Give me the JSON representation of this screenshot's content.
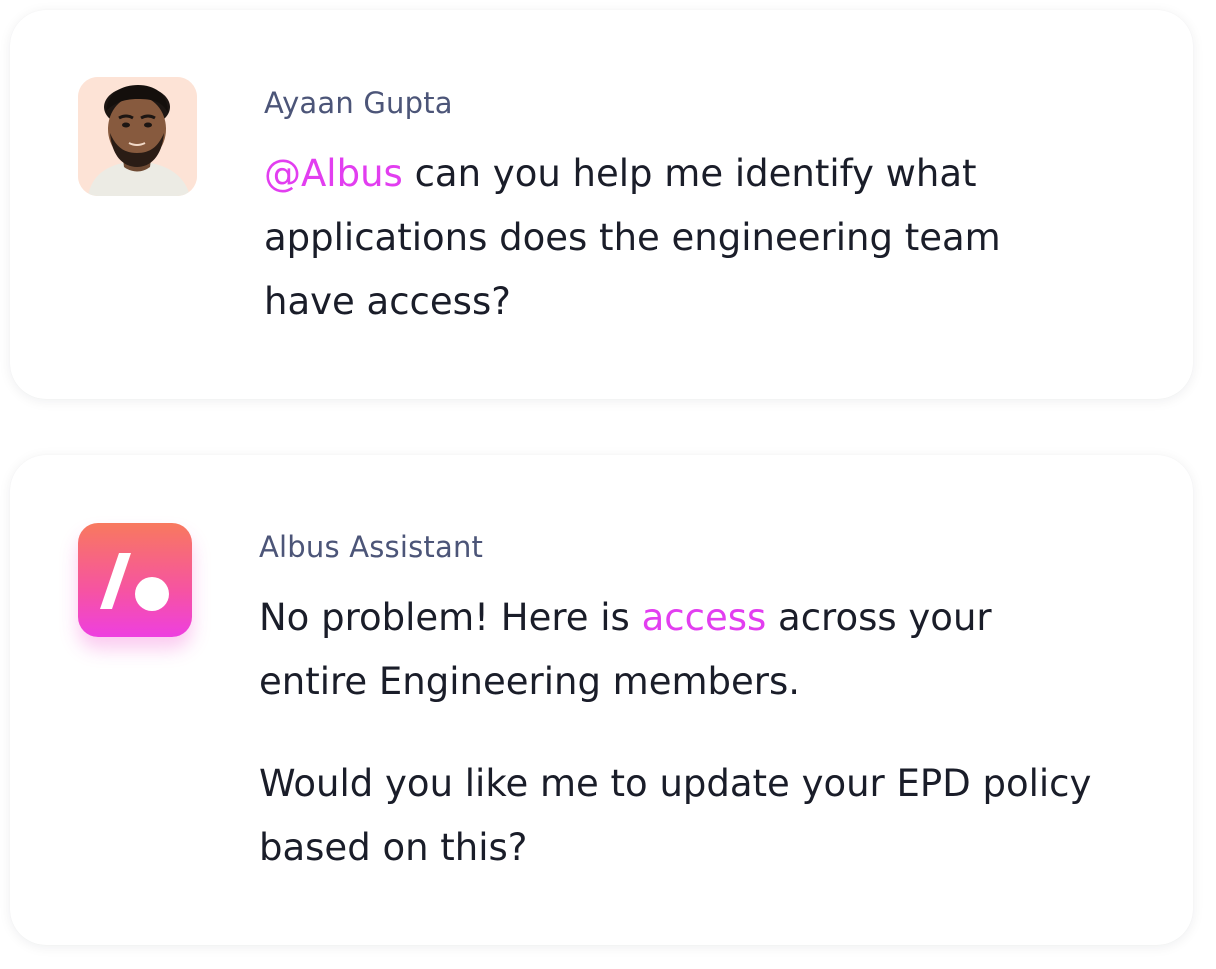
{
  "colors": {
    "accent": "#e23ef0",
    "sender_name": "#4c5578",
    "body_text": "#1a1d29",
    "card_bg": "#ffffff"
  },
  "messages": [
    {
      "sender": "Ayaan Gupta",
      "avatar": "user-photo-avatar",
      "text": {
        "mention": "@Albus",
        "line1_rest": " can you help me identify what",
        "line2": "applications does the engineering team",
        "line3": "have access?"
      }
    },
    {
      "sender": "Albus Assistant",
      "avatar": "albus-logo-icon",
      "paragraph1": {
        "before": "No problem! Here is ",
        "link": "access",
        "after": " across your",
        "line2": "entire Engineering members."
      },
      "paragraph2": {
        "line1": "Would you like me to update your EPD policy",
        "line2": "based on this?"
      }
    }
  ]
}
